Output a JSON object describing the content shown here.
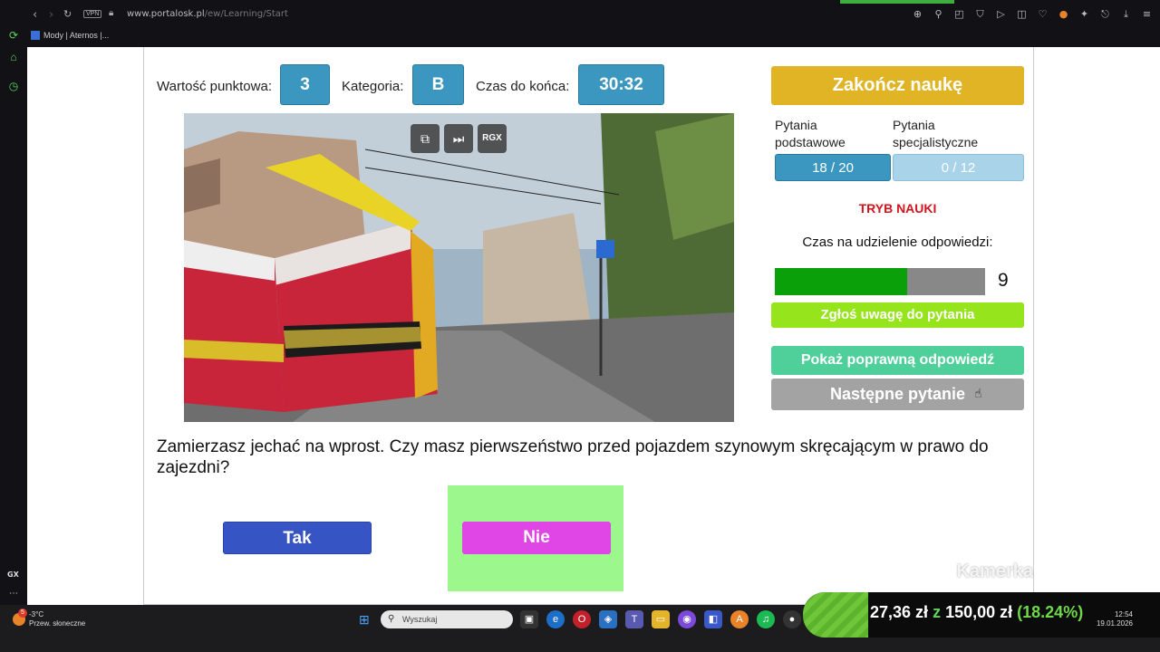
{
  "browser": {
    "url_host": "www.portalosk.pl",
    "url_path": "/ew/Learning/Start",
    "vpn_label": "VPN",
    "bookmark": "Mody | Aternos |...",
    "sidebar_gx": "GX"
  },
  "header": {
    "points_label": "Wartość punktowa:",
    "points_value": "3",
    "category_label": "Kategoria:",
    "category_value": "B",
    "time_label": "Czas do końca:",
    "time_value": "30:32"
  },
  "video": {
    "controls": [
      "popout-icon",
      "skip-icon"
    ],
    "rgx_label": "RGX"
  },
  "question": {
    "text": "Zamierzasz jechać na wprost. Czy masz pierwszeństwo przed pojazdem szynowym skręcającym w prawo do zajezdni?",
    "answer_yes": "Tak",
    "answer_no": "Nie",
    "highlight_color": "#9cf78c"
  },
  "panel": {
    "finish_label": "Zakończ naukę",
    "basic_label": "Pytania podstawowe",
    "special_label": "Pytania specjalistyczne",
    "basic_count": "18 / 20",
    "special_count": "0 / 12",
    "mode_label": "TRYB NAUKI",
    "answer_time_label": "Czas na udzielenie odpowiedzi:",
    "answer_time_value": "9",
    "answer_time_fraction": 0.63,
    "report_label": "Zgłoś uwagę do pytania",
    "show_answer_label": "Pokaż poprawną odpowiedź",
    "next_label": "Następne pytanie"
  },
  "overlay": {
    "camera_label": "Kamerka"
  },
  "taskbar": {
    "weather_temp": "-3°C",
    "weather_desc": "Przew. słoneczne",
    "weather_badge": "5",
    "search_placeholder": "Wyszukaj",
    "donation_current": "27,36 zł",
    "donation_sep": "z",
    "donation_goal": "150,00 zł",
    "donation_pct": "(18.24%)",
    "time": "12:54",
    "date": "19.01.2026"
  }
}
